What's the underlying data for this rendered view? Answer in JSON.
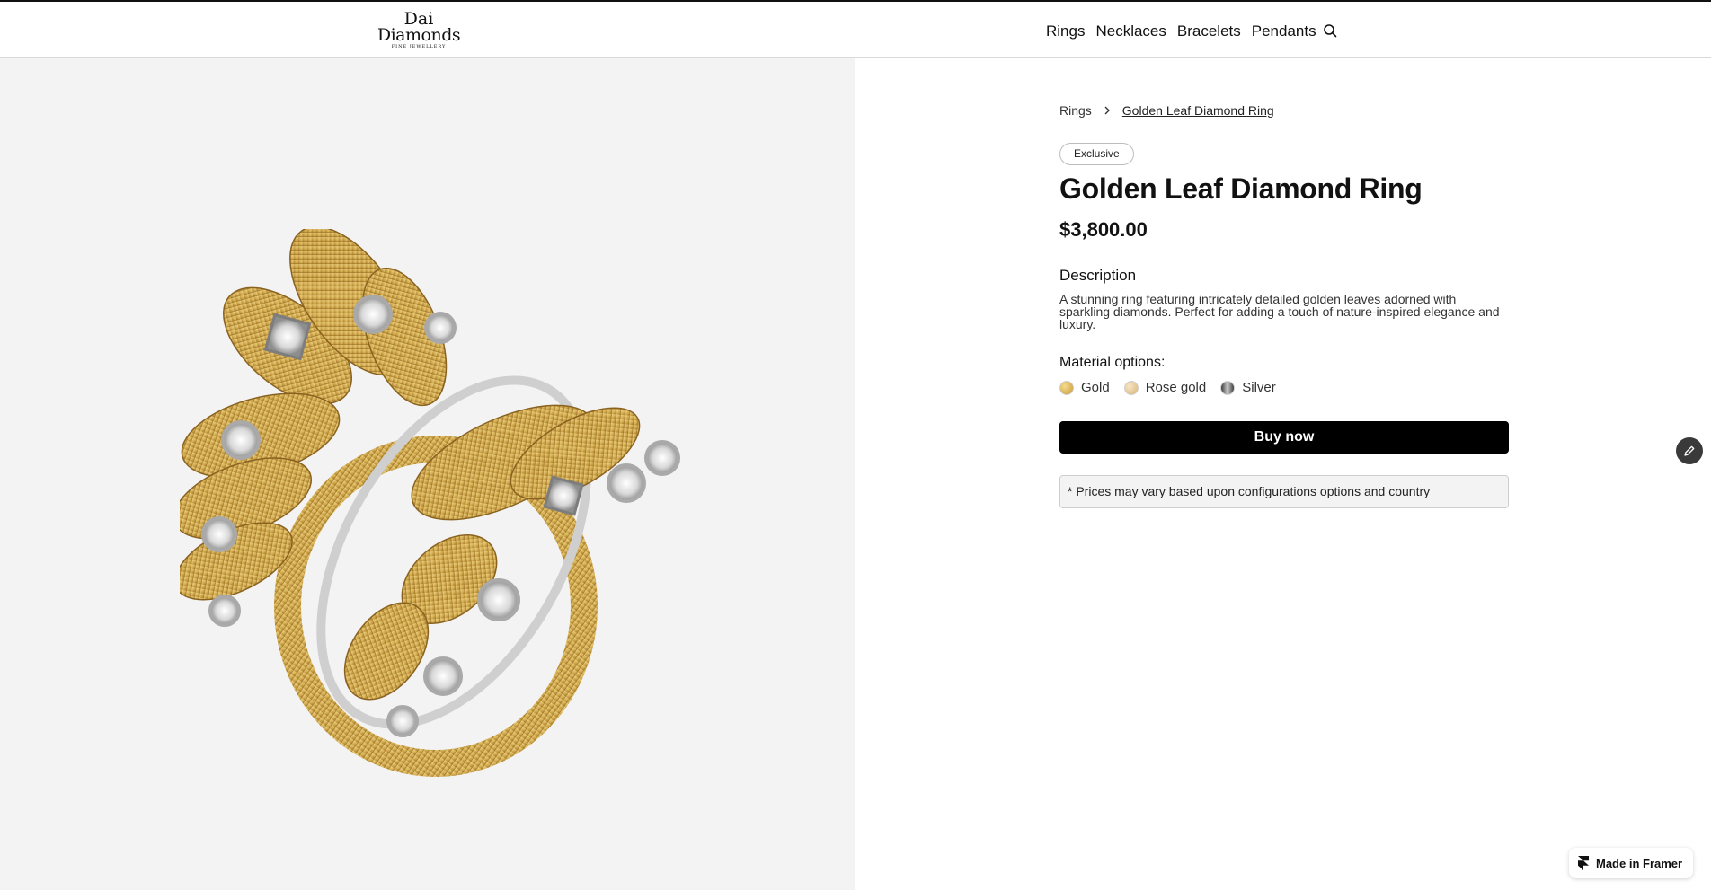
{
  "brand": {
    "line1": "Dai",
    "line2": "Diamonds",
    "tagline": "FINE JEWELLERY"
  },
  "nav": {
    "items": [
      "Rings",
      "Necklaces",
      "Bracelets",
      "Pendants"
    ],
    "search_icon": "search-icon"
  },
  "product_image": {
    "icon": "golden-leaf-ring-image",
    "colors": {
      "gold": "#d9b45a",
      "gold_dark": "#a67a26",
      "platinum": "#c9c9c9"
    }
  },
  "breadcrumb": {
    "parent": "Rings",
    "separator_icon": "chevron-right-icon",
    "current": "Golden Leaf Diamond Ring"
  },
  "product": {
    "badge": "Exclusive",
    "title": "Golden Leaf Diamond Ring",
    "price": "$3,800.00",
    "description_heading": "Description",
    "description": "A stunning ring featuring intricately detailed golden leaves adorned with sparkling diamonds. Perfect for adding a touch of nature-inspired elegance and luxury.",
    "materials_heading": "Material options:",
    "materials": [
      {
        "label": "Gold",
        "color": "#d4a94a"
      },
      {
        "label": "Rose gold",
        "color": "#e8cf9b"
      },
      {
        "label": "Silver",
        "color": "#6e6e6e"
      }
    ],
    "buy_label": "Buy now",
    "price_note": "* Prices may vary based upon configurations options and country"
  },
  "floating": {
    "edit_icon": "pencil-icon",
    "framer_label": "Made in Framer",
    "framer_icon": "framer-logo-icon"
  },
  "colors": {
    "accent": "#000000",
    "panel_bg": "#f3f3f3"
  }
}
